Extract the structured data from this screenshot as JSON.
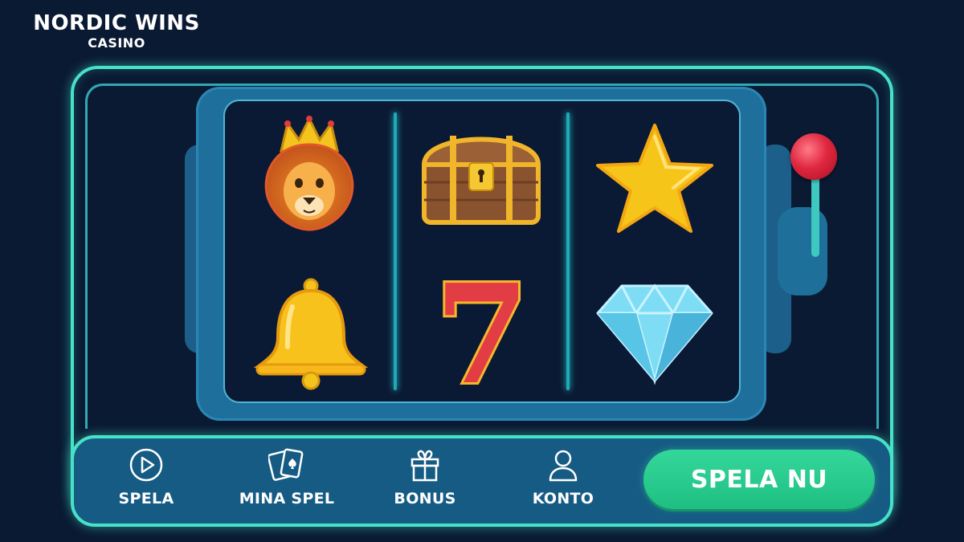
{
  "brand": {
    "title": "NORDIC WINS",
    "subtitle": "CASINO"
  },
  "reels": [
    {
      "column": 1,
      "symbols": [
        "lion-icon",
        "bell-icon"
      ]
    },
    {
      "column": 2,
      "symbols": [
        "treasure-chest-icon",
        "seven-icon"
      ]
    },
    {
      "column": 3,
      "symbols": [
        "star-icon",
        "diamond-icon"
      ]
    }
  ],
  "seven_symbol_text": "7",
  "nav": {
    "play_label": "SPELA",
    "my_games_label": "MINA SPEL",
    "bonus_label": "BONUS",
    "account_label": "KONTO"
  },
  "cta": {
    "label": "SPELA NU"
  },
  "colors": {
    "background": "#0a1a33",
    "neon_frame": "#46e2c8",
    "cabinet": "#1f6f9c",
    "cta_green": "#28c98c",
    "lever_ball": "#e0283f"
  }
}
